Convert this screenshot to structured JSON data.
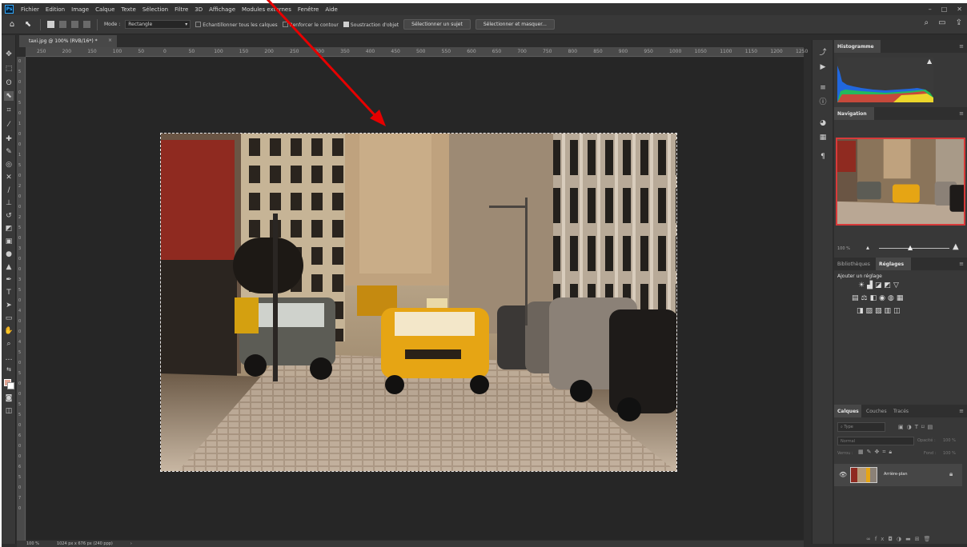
{
  "menu": {
    "items": [
      "Fichier",
      "Edition",
      "Image",
      "Calque",
      "Texte",
      "Sélection",
      "Filtre",
      "3D",
      "Affichage",
      "Modules externes",
      "Fenêtre",
      "Aide"
    ]
  },
  "window_controls": [
    "–",
    "□",
    "✕"
  ],
  "options": {
    "mode_label": "Mode :",
    "mode_value": "Rectangle",
    "sample_all_layers": "Echantillonner tous les calques",
    "enhance_edge": "Renforcer le contour",
    "object_subtraction": "Soustraction d'objet",
    "select_subject": "Sélectionner un sujet",
    "select_and_mask": "Sélectionner et masquer..."
  },
  "document": {
    "tab_title": "taxi.jpg @ 100% (RVB/16*) *",
    "ruler_marks": [
      "250",
      "200",
      "150",
      "100",
      "50",
      "0",
      "50",
      "100",
      "150",
      "200",
      "250",
      "300",
      "350",
      "400",
      "450",
      "500",
      "550",
      "600",
      "650",
      "700",
      "750",
      "800",
      "850",
      "900",
      "950",
      "1000",
      "1050",
      "1100",
      "1150",
      "1200",
      "1250"
    ],
    "ruler_vmarks": [
      "0",
      "5",
      "0",
      "0",
      "5",
      "0",
      "1",
      "0",
      "0",
      "1",
      "5",
      "0",
      "2",
      "0",
      "0",
      "2",
      "5",
      "0",
      "3",
      "0",
      "0",
      "3",
      "5",
      "0",
      "4",
      "0",
      "0",
      "4",
      "5",
      "0",
      "5",
      "0",
      "0",
      "5",
      "5",
      "0",
      "6",
      "0",
      "0",
      "6",
      "5",
      "0",
      "7",
      "0"
    ]
  },
  "status": {
    "zoom": "100 %",
    "dimensions": "1024 px x 676 px (240 ppp)",
    "arrow": "›"
  },
  "panels": {
    "histogram": {
      "title": "Histogramme"
    },
    "navigator": {
      "title": "Navigation",
      "zoom": "100 %"
    },
    "adjustments": {
      "tab_libraries": "Bibliothèques",
      "tab_adjustments": "Réglages",
      "add_label": "Ajouter un réglage"
    },
    "layers": {
      "tab_layers": "Calques",
      "tab_channels": "Couches",
      "tab_paths": "Tracés",
      "search_placeholder": "Type",
      "blend_mode": "Normal",
      "opacity_label": "Opacité :",
      "opacity_value": "100 %",
      "lock_label": "Verrou :",
      "fill_label": "Fond :",
      "fill_value": "100 %",
      "layer_name": "Arrière-plan"
    }
  },
  "colors": {
    "annotation_arrow": "#e60000",
    "foreground_swatch": "#e0a695",
    "navigator_frame": "#d83a3a",
    "accent": "#31a8ff"
  }
}
